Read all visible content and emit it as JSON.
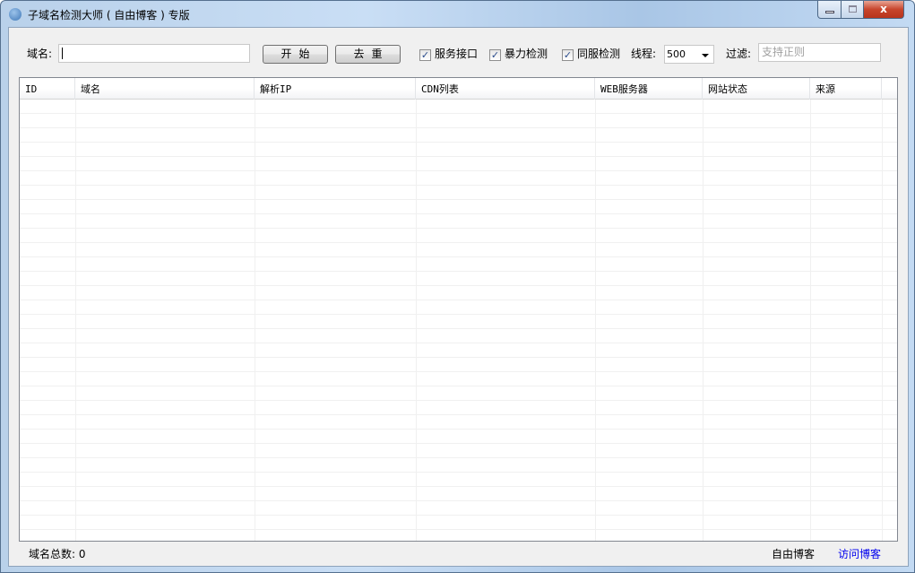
{
  "window": {
    "title": "子域名检测大师 ( 自由博客 ) 专版",
    "close_glyph": "x"
  },
  "toolbar": {
    "domain_label": "域名:",
    "domain_value": "",
    "start_label": "开始",
    "dedupe_label": "去重",
    "checkboxes": [
      {
        "label": "服务接口",
        "checked": true
      },
      {
        "label": "暴力检测",
        "checked": true
      },
      {
        "label": "同服检测",
        "checked": true
      }
    ],
    "threads_label": "线程:",
    "threads_value": "500",
    "filter_label": "过滤:",
    "filter_placeholder": "支持正则"
  },
  "table": {
    "columns": [
      "ID",
      "域名",
      "解析IP",
      "CDN列表",
      "WEB服务器",
      "网站状态",
      "来源"
    ],
    "rows": []
  },
  "status": {
    "total_label": "域名总数:",
    "total_value": "0",
    "blog_label": "自由博客",
    "visit_label": "访问博客"
  }
}
